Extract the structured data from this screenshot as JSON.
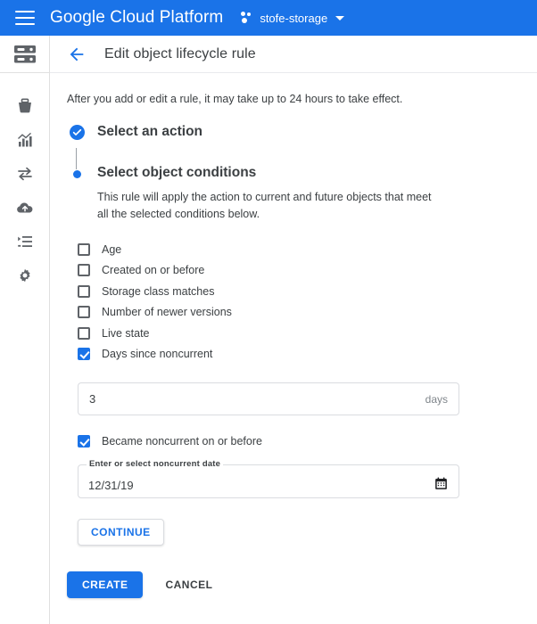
{
  "appbar": {
    "menu_icon": "hamburger-menu-icon",
    "brand": "Google Cloud Platform",
    "project": {
      "icon": "project-dots-icon",
      "name": "stofe-storage",
      "caret": "chevron-down-icon"
    }
  },
  "sidebar": {
    "selected_icon": "storage-rack-icon",
    "items": [
      {
        "icon": "bucket-icon",
        "name": "browser"
      },
      {
        "icon": "chart-bar-icon",
        "name": "monitoring"
      },
      {
        "icon": "transfer-arrows-icon",
        "name": "transfer"
      },
      {
        "icon": "cloud-upload-icon",
        "name": "transfer-appliance"
      },
      {
        "icon": "list-indent-icon",
        "name": "transfer-jobs"
      },
      {
        "icon": "gear-icon",
        "name": "settings"
      }
    ]
  },
  "page": {
    "back_icon": "back-arrow-icon",
    "title": "Edit object lifecycle rule",
    "notice": "After you add or edit a rule, it may take up to 24 hours to take effect."
  },
  "stepper": {
    "step1": {
      "title": "Select an action",
      "state": "completed",
      "marker_icon": "check-circle-icon"
    },
    "step2": {
      "title": "Select object conditions",
      "state": "active",
      "marker_icon": "active-dot-icon",
      "description": "This rule will apply the action to current and future objects that meet all the selected conditions below."
    }
  },
  "conditions": [
    {
      "label": "Age",
      "checked": false
    },
    {
      "label": "Created on or before",
      "checked": false
    },
    {
      "label": "Storage class matches",
      "checked": false
    },
    {
      "label": "Number of newer versions",
      "checked": false
    },
    {
      "label": "Live state",
      "checked": false
    },
    {
      "label": "Days since noncurrent",
      "checked": true
    }
  ],
  "days_field": {
    "value": "3",
    "suffix": "days"
  },
  "became_noncurrent": {
    "label": "Became noncurrent on or before",
    "checked": true
  },
  "date_field": {
    "label": "Enter or select noncurrent date",
    "value": "12/31/19",
    "icon": "calendar-icon"
  },
  "buttons": {
    "continue": "CONTINUE",
    "create": "CREATE",
    "cancel": "CANCEL"
  },
  "colors": {
    "brand_blue": "#1a73e8",
    "text_primary": "#3c4043",
    "text_secondary": "#80868b",
    "border": "#dadce0"
  }
}
